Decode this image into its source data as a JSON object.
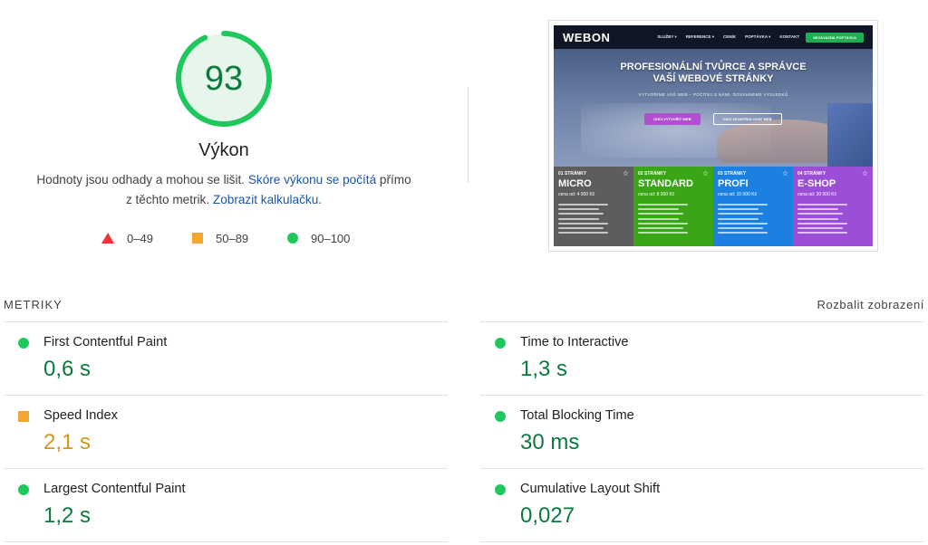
{
  "score": {
    "value": "93",
    "fraction": 0.93,
    "title": "Výkon",
    "desc_before": "Hodnoty jsou odhady a mohou se lišit. ",
    "desc_link1": "Skóre výkonu se počítá",
    "desc_middle": " přímo z těchto metrik. ",
    "desc_link2": "Zobrazit kalkulačku.",
    "color_good": "#0b7a3e",
    "ring_color": "#1fc85c",
    "ring_bg": "#e6f6ea"
  },
  "legend": {
    "bad": "0–49",
    "average": "50–89",
    "good": "90–100"
  },
  "thumbnail": {
    "logo": "WEBON",
    "menu": [
      "SLUŽBY ▾",
      "REFERENCE ▾",
      "CENÍK",
      "POPTÁVKA ▾",
      "KONTAKT"
    ],
    "cta": "NEZÁVAZNÁ POPTÁVKA",
    "hero_title_line1": "PROFESIONÁLNÍ TVŮRCE A SPRÁVCE",
    "hero_title_line2": "VAŠÍ WEBOVÉ STRÁNKY",
    "hero_sub": "VYTVOŘÍME VÁŠ WEB – POČÍTEJ S NÁMI, DOSÁHNEME VÝSLEDKŮ",
    "hero_btn1": "CHCI VYTVOŘIT WEB",
    "hero_btn2": "CHCI ZKONTROLOVAT WEB",
    "cards": [
      {
        "pre": "01 STRÁNKY",
        "name": "MICRO",
        "price": "cena od: 4 000 Kč",
        "color": "#5d5d5d"
      },
      {
        "pre": "02 STRÁNKY",
        "name": "STANDARD",
        "price": "cena od: 8 000 Kč",
        "color": "#3aa517"
      },
      {
        "pre": "03 STRÁNKY",
        "name": "PROFI",
        "price": "cena od: 15 000 Kč",
        "color": "#1b80e0"
      },
      {
        "pre": "04 STRÁNKY",
        "name": "E-SHOP",
        "price": "cena od: 20 000 Kč",
        "color": "#9b4fd6"
      }
    ]
  },
  "metrics_header": {
    "label": "METRIKY",
    "expand": "Rozbalit zobrazení"
  },
  "metrics": [
    {
      "name": "First Contentful Paint",
      "value": "0,6 s",
      "status": "good"
    },
    {
      "name": "Time to Interactive",
      "value": "1,3 s",
      "status": "good"
    },
    {
      "name": "Speed Index",
      "value": "2,1 s",
      "status": "average"
    },
    {
      "name": "Total Blocking Time",
      "value": "30 ms",
      "status": "good"
    },
    {
      "name": "Largest Contentful Paint",
      "value": "1,2 s",
      "status": "good"
    },
    {
      "name": "Cumulative Layout Shift",
      "value": "0,027",
      "status": "good"
    }
  ]
}
